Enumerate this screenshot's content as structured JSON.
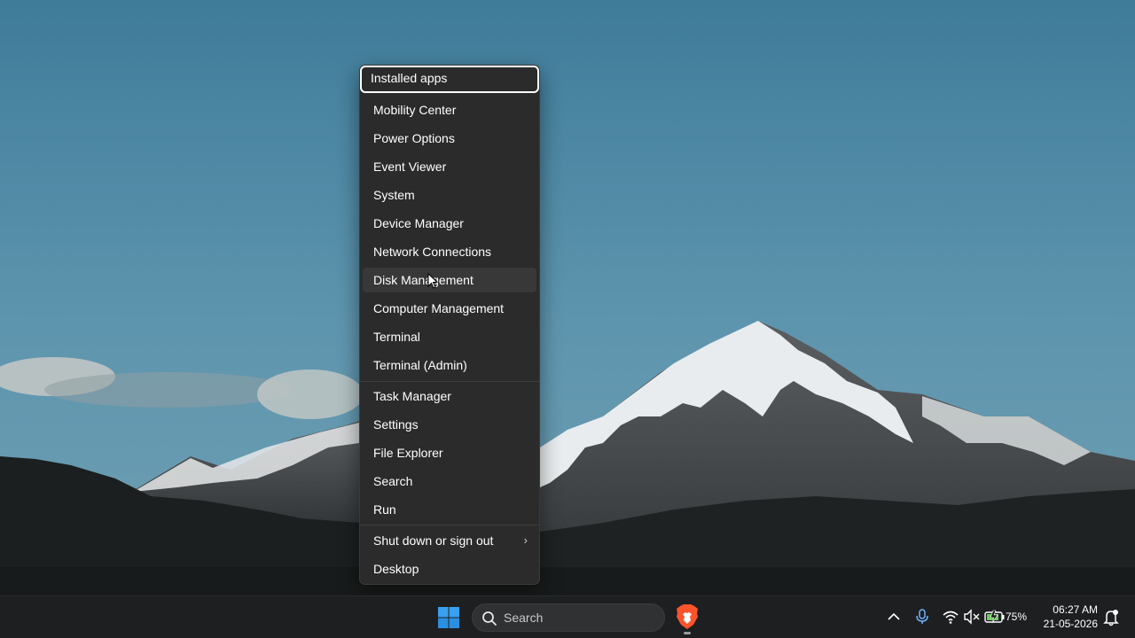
{
  "menu": {
    "items": [
      {
        "label": "Installed apps",
        "state": "focused"
      },
      {
        "label": "Mobility Center"
      },
      {
        "label": "Power Options"
      },
      {
        "label": "Event Viewer"
      },
      {
        "label": "System"
      },
      {
        "label": "Device Manager"
      },
      {
        "label": "Network Connections"
      },
      {
        "label": "Disk Management",
        "state": "hover"
      },
      {
        "label": "Computer Management"
      },
      {
        "label": "Terminal"
      },
      {
        "label": "Terminal (Admin)"
      },
      {
        "label": "Task Manager"
      },
      {
        "label": "Settings"
      },
      {
        "label": "File Explorer"
      },
      {
        "label": "Search"
      },
      {
        "label": "Run"
      },
      {
        "label": "Shut down or sign out",
        "has_submenu": true
      },
      {
        "label": "Desktop"
      }
    ],
    "submenu_arrow": "›"
  },
  "taskbar": {
    "start_icon": "windows-logo-icon",
    "search_placeholder": "Search",
    "pinned_apps": [
      {
        "name": "Brave Browser",
        "icon": "brave-icon",
        "running": true
      }
    ],
    "tray": {
      "chevron_icon": "chevron-up-icon",
      "mic_icon": "microphone-icon",
      "wifi_icon": "wifi-icon",
      "volume_icon": "volume-muted-icon",
      "battery_icon": "battery-charging-icon",
      "battery_percent": "75%"
    },
    "clock": {
      "time": "06:27 AM",
      "date": "21-05-2026"
    },
    "notification_icon": "notification-bell-icon"
  },
  "colors": {
    "accent": "#0078d4",
    "menu_bg": "#2b2b2b",
    "taskbar_bg": "#1d1f20"
  }
}
